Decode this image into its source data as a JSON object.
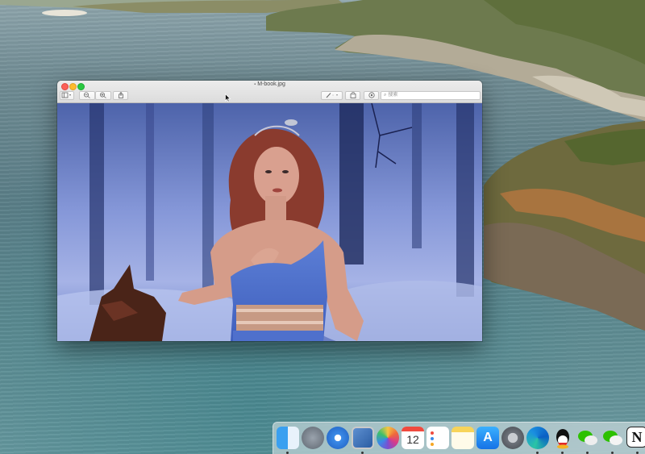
{
  "window": {
    "title": "M-book.jpg",
    "title_icon": "image-file-icon",
    "search_placeholder": "搜索",
    "toolbar_icons": [
      "sidebar-toggle-icon",
      "zoom-out-icon",
      "zoom-in-icon",
      "share-icon",
      "markup-pen-icon",
      "rotate-icon",
      "annotate-icon"
    ]
  },
  "dock": {
    "calendar_day": "12",
    "apps": [
      "finder-icon",
      "launchpad-icon",
      "safari-icon",
      "preview-icon",
      "photos-icon",
      "calendar-icon",
      "reminders-icon",
      "notes-icon",
      "app-store-icon",
      "system-preferences-icon",
      "edge-icon",
      "qq-icon",
      "wechat-icon",
      "wechat-work-icon",
      "notion-icon"
    ]
  },
  "colors": {
    "close": "#fc5f57",
    "minimize": "#fdbb2e",
    "zoom": "#28c840"
  }
}
